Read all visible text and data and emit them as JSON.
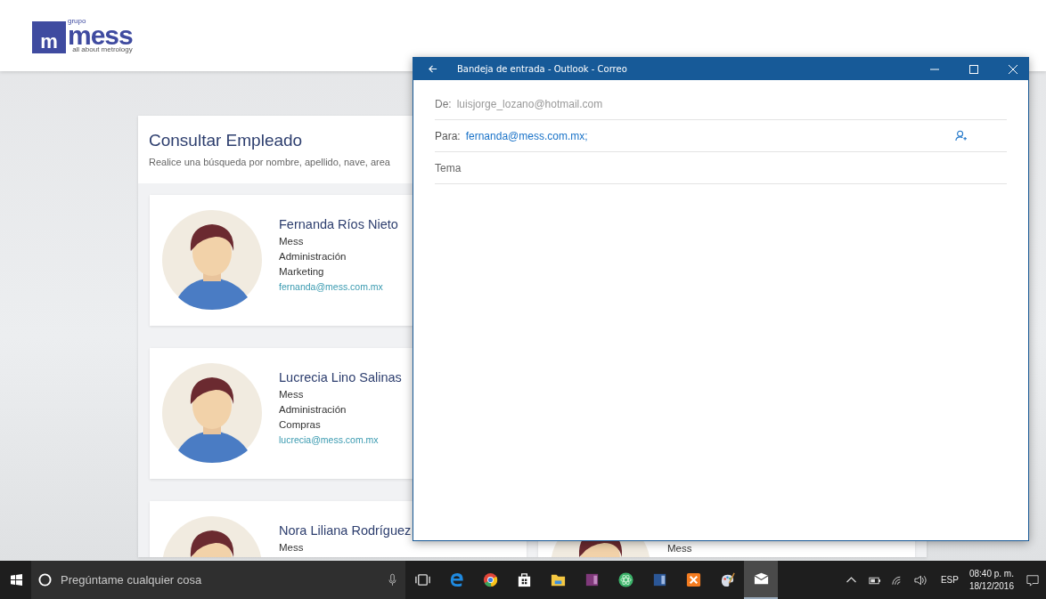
{
  "logo": {
    "mark": "m",
    "prefix": "grupo",
    "name": "mess",
    "tagline": "all about metrology"
  },
  "panel": {
    "title": "Consultar Empleado",
    "subtitle": "Realice una búsqueda por nombre, apellido, nave, area"
  },
  "employee_cards_left": [
    {
      "name": "Fernanda Ríos Nieto",
      "company": "Mess",
      "area": "Administración",
      "department": "Marketing",
      "email": "fernanda@mess.com.mx"
    },
    {
      "name": "Lucrecia Lino Salinas",
      "company": "Mess",
      "area": "Administración",
      "department": "Compras",
      "email": "lucrecia@mess.com.mx"
    },
    {
      "name": "Nora Liliana Rodríguez",
      "company": "Mess"
    }
  ],
  "employee_cards_right": [
    {
      "company": "Mess"
    }
  ],
  "mail_window": {
    "title": "Bandeja de entrada - Outlook - Correo",
    "from_label": "De:",
    "from_value": "luisjorge_lozano@hotmail.com",
    "to_label": "Para:",
    "to_value": "fernanda@mess.com.mx;",
    "subject_placeholder": "Tema"
  },
  "taskbar": {
    "search_placeholder": "Pregúntame cualquier cosa",
    "apps": [
      {
        "kind": "taskview",
        "selected": false
      },
      {
        "kind": "edge",
        "selected": false
      },
      {
        "kind": "chrome",
        "selected": false
      },
      {
        "kind": "store",
        "selected": false
      },
      {
        "kind": "folder",
        "selected": false
      },
      {
        "kind": "onenote",
        "selected": false
      },
      {
        "kind": "atom",
        "selected": false
      },
      {
        "kind": "word",
        "selected": false
      },
      {
        "kind": "xampp",
        "selected": false
      },
      {
        "kind": "paint",
        "selected": false
      },
      {
        "kind": "mail",
        "selected": true
      }
    ],
    "language": "ESP",
    "time": "08:40 p. m.",
    "date": "18/12/2016"
  }
}
